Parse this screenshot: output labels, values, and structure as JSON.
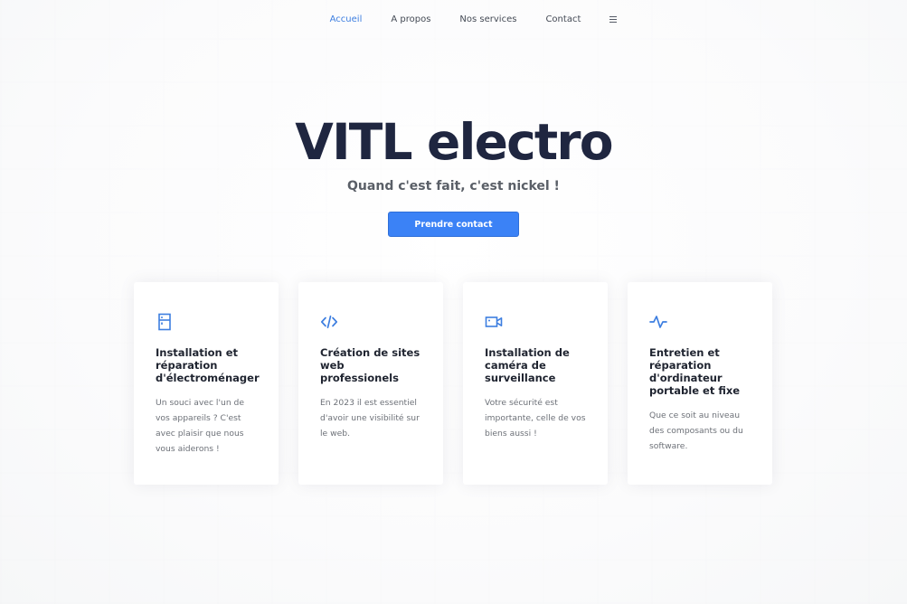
{
  "nav": {
    "items": [
      {
        "label": "Accueil",
        "active": true
      },
      {
        "label": "A propos",
        "active": false
      },
      {
        "label": "Nos services",
        "active": false
      },
      {
        "label": "Contact",
        "active": false
      }
    ],
    "menu_icon": "hamburger-icon"
  },
  "hero": {
    "title": "VITL electro",
    "subtitle": "Quand c'est fait, c'est nickel !",
    "cta_label": "Prendre contact"
  },
  "services": [
    {
      "icon": "fridge-icon",
      "title": "Installation et réparation d'électroménager",
      "text": "Un souci avec l'un de vos appareils ? C'est avec plaisir que nous vous aiderons !"
    },
    {
      "icon": "code-icon",
      "title": "Création de sites web professionels",
      "text": "En 2023 il est essentiel d'avoir une visibilité sur le web."
    },
    {
      "icon": "video-camera-icon",
      "title": "Installation de caméra de surveillance",
      "text": "Votre sécurité est importante, celle de vos biens aussi !"
    },
    {
      "icon": "activity-icon",
      "title": "Entretien et réparation d'ordinateur portable et fixe",
      "text": "Que ce soit au niveau des composants ou du software."
    }
  ],
  "colors": {
    "accent": "#3b82f6",
    "nav_active": "#3d7ee0",
    "title": "#1f2640",
    "icon": "#3d7ee0"
  }
}
